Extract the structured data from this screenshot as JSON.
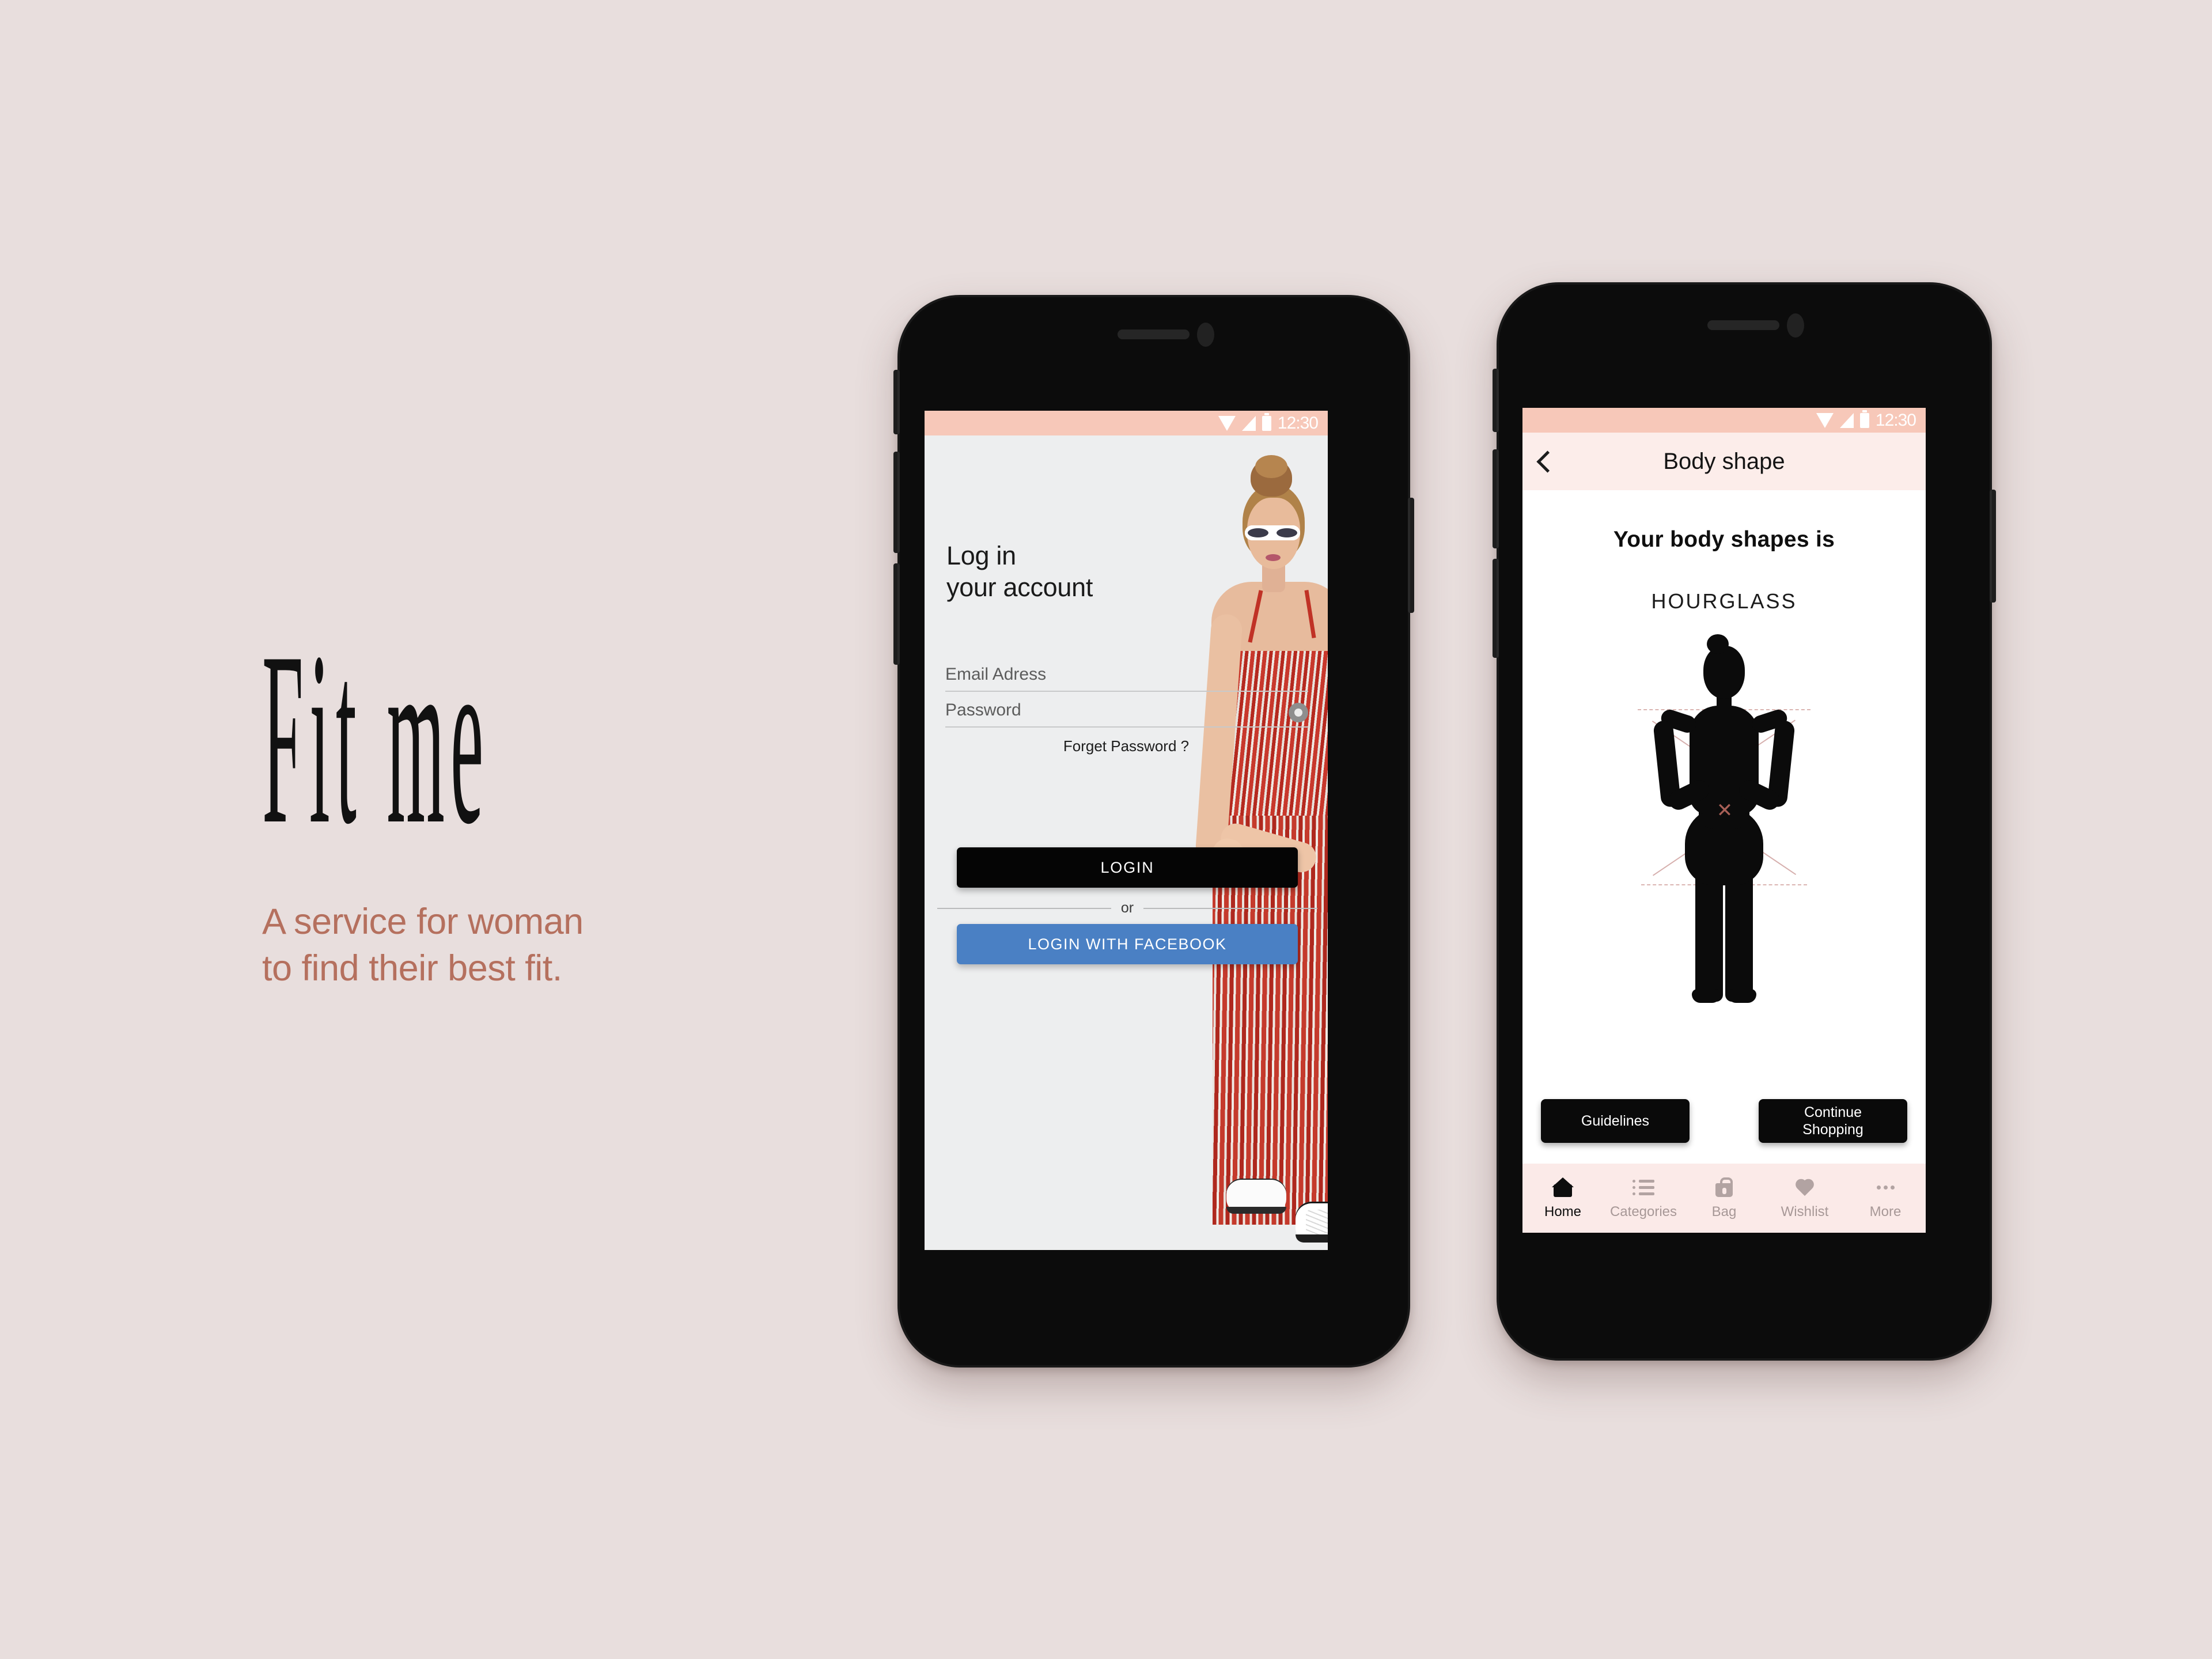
{
  "brand": {
    "logo": "Fit me",
    "tagline": "A service for woman\nto find their best fit."
  },
  "colors": {
    "page_background": "#E8DEDD",
    "status_bar": "#F7C8B9",
    "app_bar": "#FCEDEA",
    "tab_bar": "#FBEAE8",
    "accent_text": "#B5705E",
    "facebook_blue": "#4A80C4",
    "button_black": "#0A0A0A",
    "login_screen_bg": "#EDEEEF"
  },
  "phone_left": {
    "status_bar": {
      "time": "12:30",
      "icons": [
        "wifi-icon",
        "signal-icon",
        "battery-icon"
      ]
    },
    "login": {
      "headline": "Log in\nyour account",
      "email_placeholder": "Email Adress",
      "email_value": "",
      "password_placeholder": "Password",
      "password_value": "",
      "toggle_password_icon": "eye-icon",
      "forget_password": "Forget Password ?",
      "login_button": "LOGIN",
      "divider_label": "or",
      "facebook_button": "LOGIN WITH FACEBOOK"
    }
  },
  "phone_right": {
    "status_bar": {
      "time": "12:30",
      "icons": [
        "wifi-icon",
        "signal-icon",
        "battery-icon"
      ]
    },
    "app_bar": {
      "back_icon": "chevron-left-icon",
      "title": "Body shape"
    },
    "result": {
      "lead_text": "Your body shapes is",
      "shape_name": "HOURGLASS",
      "illustration": "female-body-silhouette-with-measurements"
    },
    "actions": {
      "guidelines": "Guidelines",
      "continue_shopping": "Continue\nShopping"
    },
    "tab_bar": {
      "items": [
        {
          "label": "Home",
          "icon": "home-icon",
          "active": true
        },
        {
          "label": "Categories",
          "icon": "list-icon",
          "active": false
        },
        {
          "label": "Bag",
          "icon": "bag-icon",
          "active": false
        },
        {
          "label": "Wishlist",
          "icon": "heart-icon",
          "active": false
        },
        {
          "label": "More",
          "icon": "ellipsis-icon",
          "active": false
        }
      ]
    }
  }
}
